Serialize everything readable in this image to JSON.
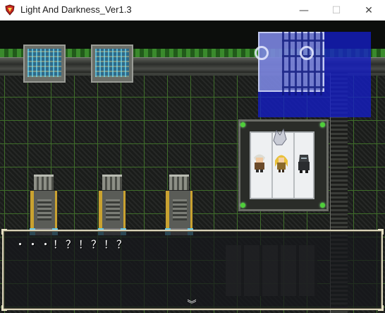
{
  "window": {
    "title": "Light And Darkness_Ver1.3",
    "controls": {
      "minimize": "—",
      "maximize": "☐",
      "close": "✕"
    },
    "icon": "app-red-emblem-icon"
  },
  "dialog": {
    "message": "・・・！？！？！？",
    "advance_icon": "double-chevron-down-icon",
    "advance_glyph": "︾"
  },
  "colors": {
    "grid_line": "#3f6d2a",
    "minimap_blue": "#1a27c8",
    "dialog_border": "#d8d2b8"
  }
}
